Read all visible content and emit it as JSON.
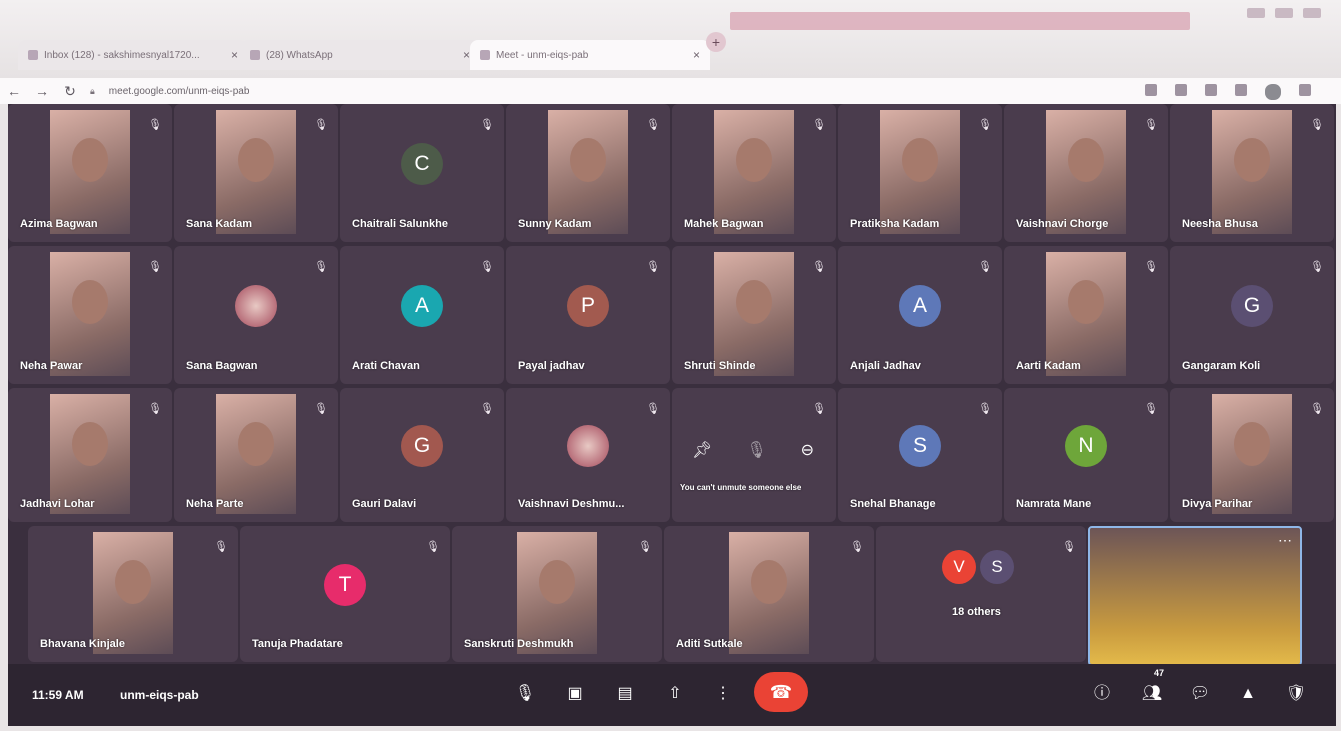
{
  "browser": {
    "tabs": [
      {
        "label": "Inbox (128) - sakshimesnyal1720...",
        "active": false
      },
      {
        "label": "(28) WhatsApp",
        "active": false
      },
      {
        "label": "Meet - unm-eiqs-pab",
        "active": true
      }
    ],
    "new_tab_label": "+",
    "url": "meet.google.com/unm-eiqs-pab"
  },
  "participants": [
    {
      "name": "Azima Bagwan",
      "tile": "video"
    },
    {
      "name": "Sana Kadam",
      "tile": "video"
    },
    {
      "name": "Chaitrali Salunkhe",
      "tile": "initial",
      "initial": "C",
      "color": "#4d5b49"
    },
    {
      "name": "Sunny Kadam",
      "tile": "video"
    },
    {
      "name": "Mahek Bagwan",
      "tile": "video"
    },
    {
      "name": "Pratiksha Kadam",
      "tile": "video"
    },
    {
      "name": "Vaishnavi Chorge",
      "tile": "video"
    },
    {
      "name": "Neesha Bhusa",
      "tile": "video"
    },
    {
      "name": "Neha Pawar",
      "tile": "video"
    },
    {
      "name": "Sana Bagwan",
      "tile": "avatar"
    },
    {
      "name": "Arati Chavan",
      "tile": "initial",
      "initial": "A",
      "color": "#1aa7b0"
    },
    {
      "name": "Payal jadhav",
      "tile": "initial",
      "initial": "P",
      "color": "#a25a4f"
    },
    {
      "name": "Shruti Shinde",
      "tile": "video"
    },
    {
      "name": "Anjali Jadhav",
      "tile": "initial",
      "initial": "A",
      "color": "#5e78b8"
    },
    {
      "name": "Aarti Kadam",
      "tile": "video"
    },
    {
      "name": "Gangaram Koli",
      "tile": "initial",
      "initial": "G",
      "color": "#5b4f72"
    },
    {
      "name": "Jadhavi Lohar",
      "tile": "video"
    },
    {
      "name": "Neha Parte",
      "tile": "video"
    },
    {
      "name": "Gauri Dalavi",
      "tile": "initial",
      "initial": "G",
      "color": "#a2584f"
    },
    {
      "name": "Vaishnavi Deshmu...",
      "tile": "avatar"
    },
    {
      "name": "You can't unmute someone else",
      "tile": "hover"
    },
    {
      "name": "Snehal Bhanage",
      "tile": "initial",
      "initial": "S",
      "color": "#5e78b8"
    },
    {
      "name": "Namrata Mane",
      "tile": "initial",
      "initial": "N",
      "color": "#6ea63a"
    },
    {
      "name": "Divya Parihar",
      "tile": "video"
    },
    {
      "name": "Bhavana Kinjale",
      "tile": "video"
    },
    {
      "name": "Tanuja Phadatare",
      "tile": "initial",
      "initial": "T",
      "color": "#e72c6b"
    },
    {
      "name": "Sanskruti Deshmukh",
      "tile": "video"
    },
    {
      "name": "Aditi Sutkale",
      "tile": "video"
    },
    {
      "name": "18 others",
      "tile": "others"
    },
    {
      "name": "",
      "tile": "self"
    }
  ],
  "others": {
    "initial_1": "V",
    "color_1": "#ea4335",
    "initial_2": "S",
    "color_2": "#5b4f72",
    "label": "18 others"
  },
  "bottom": {
    "clock": "11:59 AM",
    "meeting_code": "unm-eiqs-pab",
    "participants_count": "47"
  },
  "colors": {
    "stage": "#3a2f3e",
    "tile": "#4a3c4d",
    "end_call": "#ea4335"
  }
}
